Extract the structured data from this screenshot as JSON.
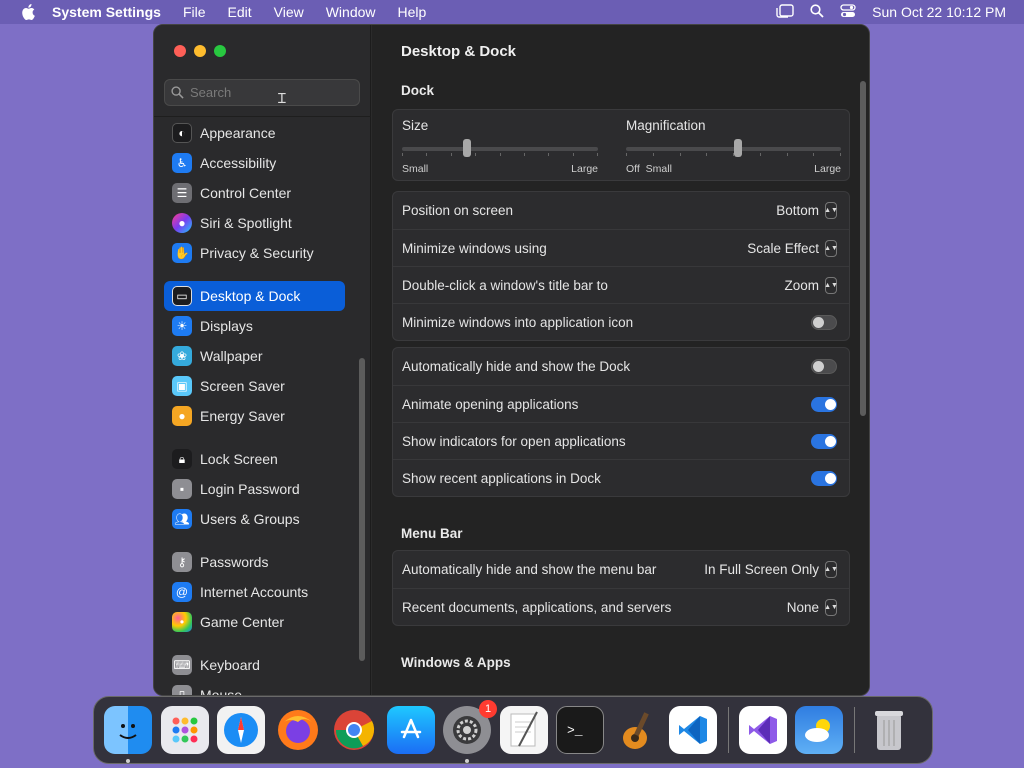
{
  "menubar": {
    "app_name": "System Settings",
    "items": [
      "File",
      "Edit",
      "View",
      "Window",
      "Help"
    ],
    "clock": "Sun Oct 22  10:12 PM"
  },
  "sidebar": {
    "search_placeholder": "Search",
    "items": [
      {
        "label": "Appearance",
        "icon": "appearance-icon",
        "color": "#1c1c1e"
      },
      {
        "label": "Accessibility",
        "icon": "accessibility-icon",
        "color": "#1e7bf2"
      },
      {
        "label": "Control Center",
        "icon": "control-center-icon",
        "color": "#6e6e73"
      },
      {
        "label": "Siri & Spotlight",
        "icon": "siri-icon",
        "color": "#b43ad6"
      },
      {
        "label": "Privacy & Security",
        "icon": "hand-icon",
        "color": "#1e7bf2"
      },
      {
        "label": "Desktop & Dock",
        "icon": "desktop-dock-icon",
        "color": "#1c1c1e",
        "selected": true
      },
      {
        "label": "Displays",
        "icon": "displays-icon",
        "color": "#1e7bf2"
      },
      {
        "label": "Wallpaper",
        "icon": "wallpaper-icon",
        "color": "#35aadc"
      },
      {
        "label": "Screen Saver",
        "icon": "screen-saver-icon",
        "color": "#5ac8fa"
      },
      {
        "label": "Energy Saver",
        "icon": "energy-saver-icon",
        "color": "#f5a623"
      },
      {
        "label": "Lock Screen",
        "icon": "lock-icon",
        "color": "#1c1c1e"
      },
      {
        "label": "Login Password",
        "icon": "login-password-icon",
        "color": "#8e8e93"
      },
      {
        "label": "Users & Groups",
        "icon": "users-groups-icon",
        "color": "#1e7bf2"
      },
      {
        "label": "Passwords",
        "icon": "key-icon",
        "color": "#8e8e93"
      },
      {
        "label": "Internet Accounts",
        "icon": "at-icon",
        "color": "#1e7bf2"
      },
      {
        "label": "Game Center",
        "icon": "game-center-icon",
        "color": "#ffffff"
      },
      {
        "label": "Keyboard",
        "icon": "keyboard-icon",
        "color": "#8e8e93"
      },
      {
        "label": "Mouse",
        "icon": "mouse-icon",
        "color": "#8e8e93"
      }
    ]
  },
  "content": {
    "title": "Desktop & Dock",
    "dock_section": "Dock",
    "size": {
      "label": "Size",
      "min": "Small",
      "max": "Large",
      "value_fraction": 0.33
    },
    "magnification": {
      "label": "Magnification",
      "off": "Off",
      "min": "Small",
      "max": "Large",
      "value_fraction": 0.52
    },
    "settings_rows": [
      {
        "label": "Position on screen",
        "value": "Bottom"
      },
      {
        "label": "Minimize windows using",
        "value": "Scale Effect"
      },
      {
        "label": "Double-click a window's title bar to",
        "value": "Zoom"
      },
      {
        "label": "Minimize windows into application icon",
        "toggle": false
      }
    ],
    "dock_toggles": [
      {
        "label": "Automatically hide and show the Dock",
        "toggle": false
      },
      {
        "label": "Animate opening applications",
        "toggle": true
      },
      {
        "label": "Show indicators for open applications",
        "toggle": true
      },
      {
        "label": "Show recent applications in Dock",
        "toggle": true
      }
    ],
    "menu_bar_section": "Menu Bar",
    "menu_bar_rows": [
      {
        "label": "Automatically hide and show the menu bar",
        "value": "In Full Screen Only"
      },
      {
        "label": "Recent documents, applications, and servers",
        "value": "None"
      }
    ],
    "windows_apps_section": "Windows & Apps"
  },
  "dock": {
    "apps": [
      {
        "name": "finder",
        "color": "#1f8cf0",
        "running": true
      },
      {
        "name": "launchpad",
        "color": "#e9e9ee"
      },
      {
        "name": "safari",
        "color": "#f2f2f2"
      },
      {
        "name": "firefox",
        "color": "#7b3fe4"
      },
      {
        "name": "chrome",
        "color": "#ffffff"
      },
      {
        "name": "app-store",
        "color": "#1b8df5"
      },
      {
        "name": "system-settings",
        "color": "#8e8e93",
        "running": true,
        "badge": "1"
      },
      {
        "name": "textedit",
        "color": "#f5f5f5"
      },
      {
        "name": "terminal",
        "color": "#1a1a1a"
      },
      {
        "name": "garageband",
        "color": "#3a2a1a"
      },
      {
        "name": "vscode",
        "color": "#ffffff"
      }
    ],
    "recent": [
      {
        "name": "visual-studio",
        "color": "#ffffff"
      },
      {
        "name": "weather",
        "color": "#2f7de1"
      }
    ],
    "trash": {
      "name": "trash",
      "color": "#c7c7cc"
    }
  }
}
